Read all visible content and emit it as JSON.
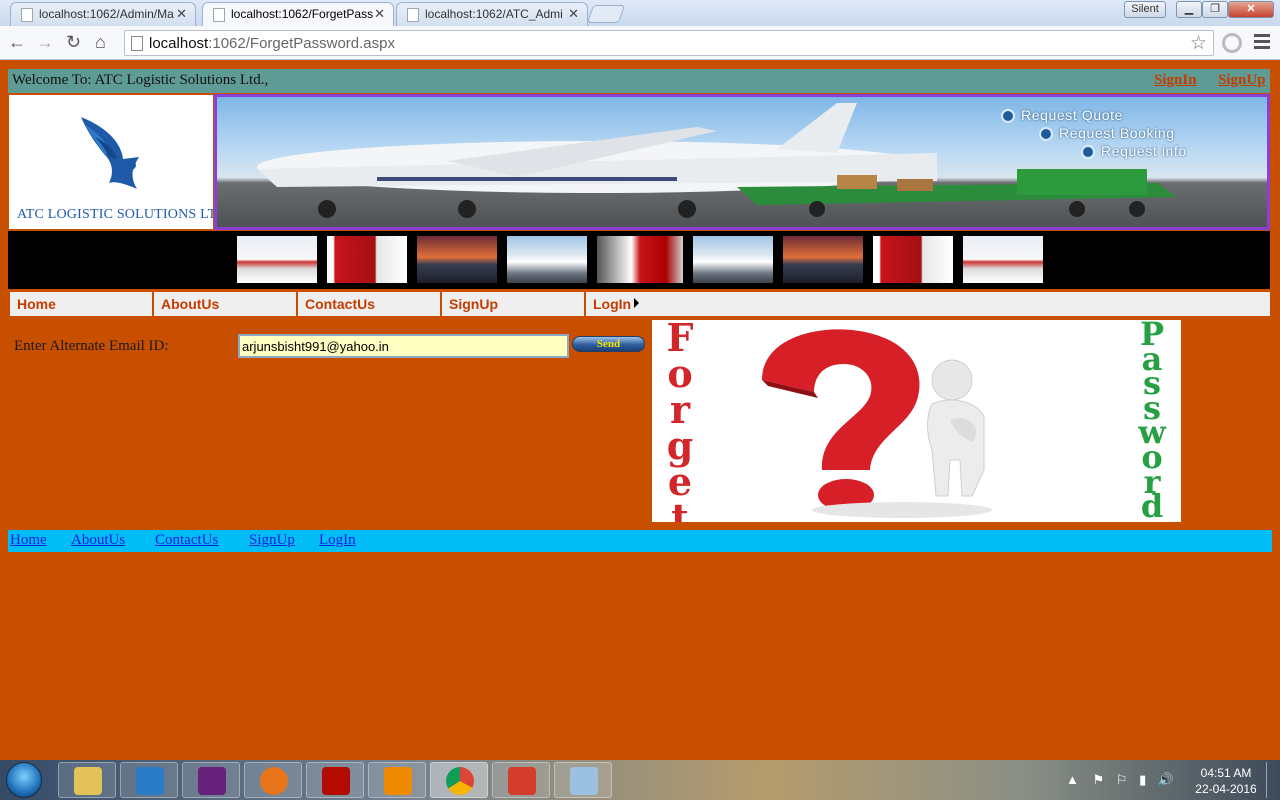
{
  "browser": {
    "tabs": [
      {
        "title": "localhost:1062/Admin/Ma",
        "active": false
      },
      {
        "title": "localhost:1062/ForgetPass",
        "active": true
      },
      {
        "title": "localhost:1062/ATC_Admi",
        "active": false
      }
    ],
    "profile_label": "Silent",
    "url_host": "localhost",
    "url_rest": ":1062/ForgetPassword.aspx"
  },
  "page": {
    "welcome": "Welcome To: ATC Logistic Solutions Ltd.,",
    "signin": "SignIn",
    "signup": "SignUp",
    "logo_text": "ATC LOGISTIC SOLUTIONS LTD.,",
    "banner_links": [
      "Request Quote",
      "Request Booking",
      "Request info"
    ],
    "menu": [
      "Home",
      "AboutUs",
      "ContactUs",
      "SignUp",
      "LogIn"
    ],
    "email_label": "Enter Alternate Email ID:",
    "email_value": "arjunsbisht991@yahoo.in",
    "send_label": "Send",
    "image_word_left": [
      "F",
      "o",
      "r",
      "g",
      "e",
      "t"
    ],
    "image_word_right": [
      "P",
      "a",
      "s",
      "s",
      "w",
      "o",
      "r",
      "d"
    ],
    "footer_links": [
      "Home",
      "AboutUs",
      "ContactUs",
      "SignUp",
      "LogIn"
    ]
  },
  "taskbar": {
    "time": "04:51 AM",
    "date": "22-04-2016"
  },
  "colors": {
    "page_bg": "#c94f00",
    "welcome_bar": "#5e9b94",
    "link_orange": "#c43c00",
    "footer_bar": "#00bdf5",
    "banner_border": "#8a3fd6",
    "input_bg": "#ffffc2"
  }
}
